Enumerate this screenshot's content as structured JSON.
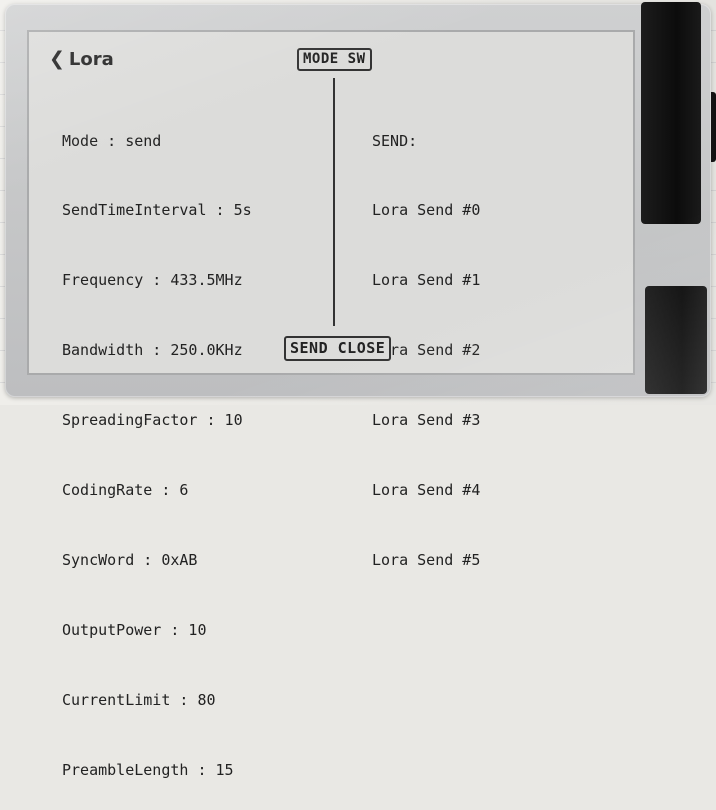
{
  "header": {
    "back_label": "Lora",
    "mode_button": "MODE SW"
  },
  "settings": [
    "Mode : send",
    "SendTimeInterval : 5s",
    "Frequency : 433.5MHz",
    "Bandwidth : 250.0KHz",
    "SpreadingFactor : 10",
    "CodingRate : 6",
    "SyncWord : 0xAB",
    "OutputPower : 10",
    "CurrentLimit : 80",
    "PreambleLength : 15"
  ],
  "send_log": {
    "title": "SEND:",
    "entries": [
      "Lora Send #0",
      "Lora Send #1",
      "Lora Send #2",
      "Lora Send #3",
      "Lora Send #4",
      "Lora Send #5"
    ]
  },
  "footer": {
    "close_button": "SEND CLOSE"
  },
  "icons": {
    "back": "chevron-left-icon"
  }
}
